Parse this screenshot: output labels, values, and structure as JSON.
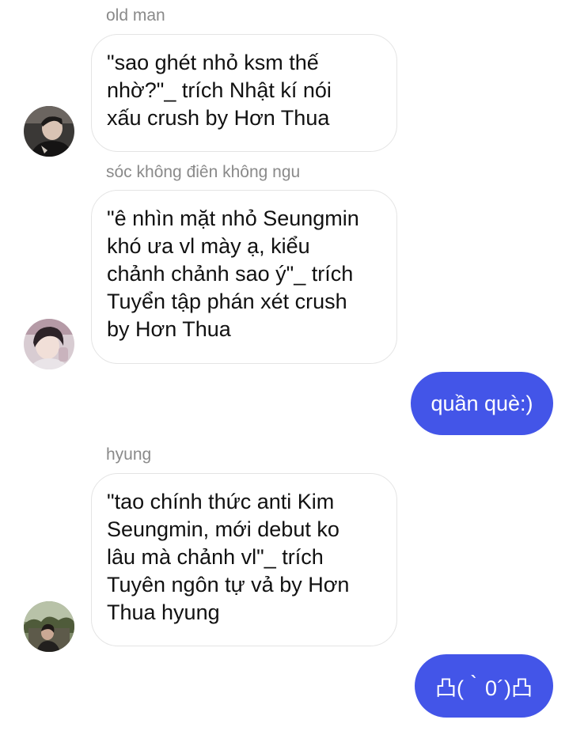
{
  "colors": {
    "outgoing_bubble": "#4355e8",
    "outgoing_text": "#ffffff",
    "incoming_border": "#e4e4e4",
    "sender_name": "#8a8a8a"
  },
  "messages": [
    {
      "direction": "incoming",
      "sender": "old man",
      "avatar_icon": "avatar-photo-icon",
      "lines": [
        "\"sao ghét nhỏ ksm thế",
        "nhờ?\"_ trích Nhật kí nói",
        "xấu crush by Hơn Thua"
      ]
    },
    {
      "direction": "incoming",
      "sender": "sóc không điên không ngu",
      "avatar_icon": "avatar-photo-icon",
      "lines": [
        "\"ê nhìn mặt nhỏ Seungmin",
        "khó ưa vl mày ạ, kiểu",
        "chảnh chảnh sao ý\"_ trích",
        "Tuyển tập phán xét crush",
        "by Hơn Thua"
      ]
    },
    {
      "direction": "outgoing",
      "text": "quần què:)"
    },
    {
      "direction": "incoming",
      "sender": "hyung",
      "avatar_icon": "avatar-photo-icon",
      "lines": [
        "\"tao chính thức anti Kim",
        "Seungmin, mới debut ko",
        "lâu mà chảnh vl\"_ trích",
        "Tuyên ngôn tự vả by Hơn",
        "Thua hyung"
      ]
    },
    {
      "direction": "outgoing",
      "text": "凸(｀0´)凸"
    }
  ]
}
